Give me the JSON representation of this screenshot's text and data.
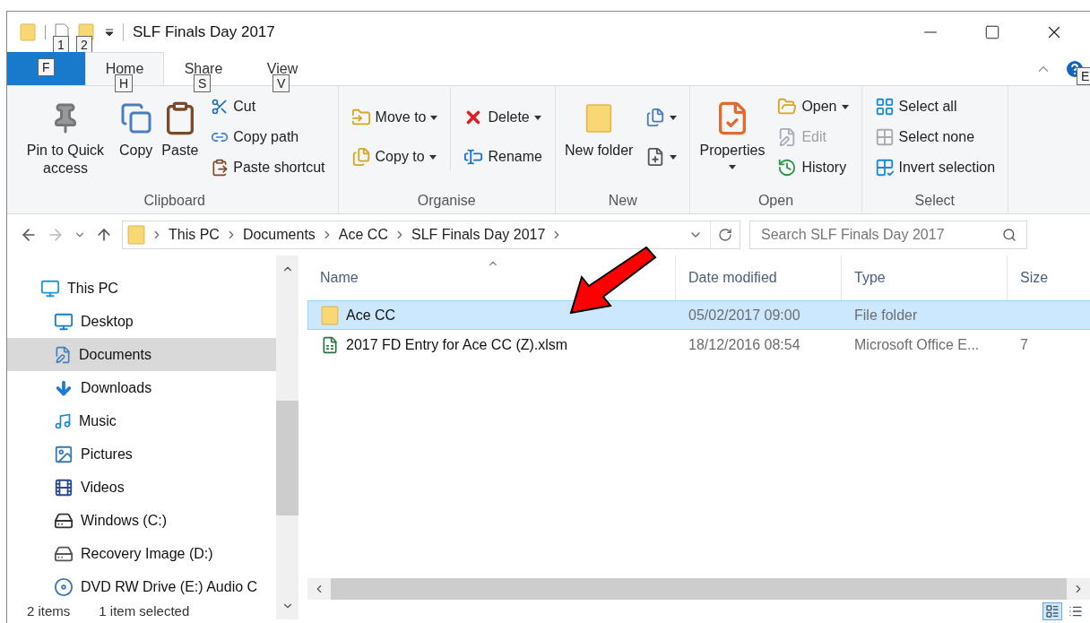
{
  "window": {
    "title": "SLF Finals Day 2017",
    "quick_access_keytips": [
      "1",
      "2"
    ]
  },
  "ribbon": {
    "tabs": [
      {
        "kind": "file",
        "keytip": "F",
        "selected": false
      },
      {
        "kind": "tab",
        "label": "Home",
        "keytip": "H",
        "selected": true
      },
      {
        "kind": "tab",
        "label": "Share",
        "keytip": "S",
        "selected": false
      },
      {
        "kind": "tab",
        "label": "View",
        "keytip": "V",
        "selected": false
      }
    ],
    "help_keytip": "E",
    "groups": [
      {
        "label": "Clipboard",
        "columns": [
          {
            "kind": "large",
            "label": "Pin to Quick access"
          },
          {
            "kind": "large",
            "label": "Copy"
          },
          {
            "kind": "large",
            "label": "Paste"
          },
          {
            "kind": "stack",
            "items": [
              {
                "label": "Cut"
              },
              {
                "label": "Copy path"
              },
              {
                "label": "Paste shortcut"
              }
            ]
          }
        ]
      },
      {
        "label": "Organise",
        "columns": [
          {
            "kind": "stack",
            "items": [
              {
                "label": "Move to",
                "dropdown": true
              },
              {
                "label": "Copy to",
                "dropdown": true
              }
            ]
          },
          {
            "kind": "stack",
            "items": [
              {
                "label": "Delete",
                "dropdown": true
              },
              {
                "label": "Rename"
              }
            ]
          }
        ]
      },
      {
        "label": "New",
        "columns": [
          {
            "kind": "large",
            "label": "New folder"
          },
          {
            "kind": "stack",
            "items": [
              {
                "dropdown": true
              },
              {
                "dropdown": true
              }
            ]
          }
        ]
      },
      {
        "label": "Open",
        "columns": [
          {
            "kind": "large",
            "label": "Properties",
            "dropdown": true
          },
          {
            "kind": "stack",
            "items": [
              {
                "label": "Open",
                "dropdown": true
              },
              {
                "label": "Edit",
                "disabled": true
              },
              {
                "label": "History"
              }
            ]
          }
        ]
      },
      {
        "label": "Select",
        "columns": [
          {
            "kind": "stack",
            "items": [
              {
                "label": "Select all"
              },
              {
                "label": "Select none"
              },
              {
                "label": "Invert selection"
              }
            ]
          }
        ]
      }
    ]
  },
  "address": {
    "crumbs": [
      "This PC",
      "Documents",
      "Ace CC",
      "SLF Finals Day 2017"
    ],
    "search": {
      "placeholder": "Search SLF Finals Day 2017"
    }
  },
  "navigation": {
    "items": [
      {
        "label": "This PC",
        "selected": false,
        "children": [
          {
            "label": "Desktop",
            "selected": false
          },
          {
            "label": "Documents",
            "selected": true
          },
          {
            "label": "Downloads",
            "selected": false
          },
          {
            "label": "Music",
            "selected": false
          },
          {
            "label": "Pictures",
            "selected": false
          },
          {
            "label": "Videos",
            "selected": false
          },
          {
            "label": "Windows (C:)",
            "selected": false
          },
          {
            "label": "Recovery Image (D:)",
            "selected": false
          },
          {
            "label": "DVD RW Drive (E:) Audio C",
            "selected": false
          }
        ]
      }
    ]
  },
  "table": {
    "columns": [
      "Name",
      "Date modified",
      "Type",
      "Size"
    ],
    "rows": [
      {
        "kind": "folder",
        "name": "Ace CC",
        "date": "05/02/2017 09:00",
        "type": "File folder",
        "selected": true
      },
      {
        "kind": "excel",
        "name": "2017 FD Entry for Ace CC (Z).xlsm",
        "date": "18/12/2016 08:54",
        "type": "Microsoft Office E...",
        "size": "7",
        "selected": false
      }
    ]
  },
  "status_bar": {
    "items": [
      "2 items",
      "1 item selected"
    ],
    "views": [
      {
        "selected": true
      },
      {
        "selected": false
      }
    ]
  }
}
